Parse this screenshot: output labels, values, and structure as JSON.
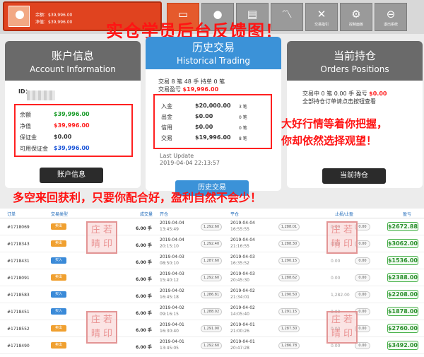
{
  "user": {
    "balance_label": "余额：",
    "balance": "$39,996.00",
    "equity_label": "净值：",
    "equity": "$39,996.00"
  },
  "nav": [
    "",
    "",
    "",
    "",
    "交易指引",
    "控制面板",
    "退出系统"
  ],
  "banner_top": "实仓学员后台反馈图！",
  "account": {
    "title_cn": "账户信息",
    "title_en": "Account Information",
    "id_label": "ID：",
    "rows": [
      {
        "label": "余额",
        "value": "$39,996.00"
      },
      {
        "label": "净值",
        "value": "$39,996.00"
      },
      {
        "label": "保证金",
        "value": "$0.00"
      },
      {
        "label": "可用保证金",
        "value": "$39,996.00"
      }
    ],
    "button": "账户信息"
  },
  "history": {
    "title_cn": "历史交易",
    "title_en": "Historical Trading",
    "summary1": "交易 8 笔   48 手   持单 0 笔",
    "summary2_label": "交易盈亏",
    "summary2_value": "$19,996.00",
    "rows": [
      {
        "label": "入金",
        "value": "$20,000.00",
        "extra": "3 笔"
      },
      {
        "label": "出金",
        "value": "$0.00",
        "extra": "0 笔"
      },
      {
        "label": "信用",
        "value": "$0.00",
        "extra": "0 笔"
      },
      {
        "label": "交易",
        "value": "$19,996.00",
        "extra": "8 笔"
      }
    ],
    "last_update_label": "Last Update",
    "last_update": "2019-04-04 22:13:57",
    "button": "历史交易"
  },
  "positions": {
    "title_cn": "当前持仓",
    "title_en": "Orders Positions",
    "summary1": "交易中 0 笔   0.00 手   盈亏",
    "summary1_value": "$0.00",
    "summary2": "全部持仓订单请点击按钮查看",
    "button": "当前持仓"
  },
  "annotation_right_1": "大好行情等着你把握，",
  "annotation_right_2": "你却依然选择观望！",
  "annotation_mid": "多空来回获利，只要你配合好，盈利自然不会少！",
  "table": {
    "headers": [
      "订单",
      "交易类型",
      "成交量",
      "开仓",
      "平仓",
      "止损/止盈",
      "盈亏"
    ],
    "rows": [
      {
        "order": "#1718069",
        "type": "卖出",
        "side": "sell",
        "vol": "6.00 手",
        "open_date": "2019-04-04",
        "open_time": "13:45:49",
        "open_price": "1,292.60",
        "close_date": "2019-04-04",
        "close_time": "16:55:55",
        "close_price": "1,288.01",
        "sl": "0.00",
        "profit": "$2672.88"
      },
      {
        "order": "#1718343",
        "type": "卖出",
        "side": "sell",
        "vol": "6.00 手",
        "open_date": "2019-04-04",
        "open_time": "20:15:10",
        "open_price": "1,292.40",
        "close_date": "2019-04-04",
        "close_time": "21:16:55",
        "close_price": "1,288.30",
        "sl": "0.00",
        "profit": "$3062.00"
      },
      {
        "order": "#1718431",
        "type": "买入",
        "side": "buy",
        "vol": "6.00 手",
        "open_date": "2019-04-03",
        "open_time": "08:50:10",
        "open_price": "1,287.60",
        "close_date": "2019-04-03",
        "close_time": "16:35:52",
        "close_price": "1,290.15",
        "sl": "0.00",
        "profit": "$1536.00"
      },
      {
        "order": "#1718091",
        "type": "卖出",
        "side": "sell",
        "vol": "6.00 手",
        "open_date": "2019-04-03",
        "open_time": "15:40:12",
        "open_price": "1,292.60",
        "close_date": "2019-04-03",
        "close_time": "20:45:30",
        "close_price": "1,288.62",
        "sl": "0.00",
        "profit": "$2388.00"
      },
      {
        "order": "#1718583",
        "type": "买入",
        "side": "buy",
        "vol": "6.00 手",
        "open_date": "2019-04-02",
        "open_time": "16:45:18",
        "open_price": "1,286.81",
        "close_date": "2019-04-02",
        "close_time": "21:34:01",
        "close_price": "1,290.50",
        "sl": "1,282.00",
        "profit": "$2208.00"
      },
      {
        "order": "#1718451",
        "type": "买入",
        "side": "buy",
        "vol": "6.00 手",
        "open_date": "2019-04-02",
        "open_time": "09:16:15",
        "open_price": "1,288.02",
        "close_date": "2019-04-02",
        "close_time": "14:05:40",
        "close_price": "1,291.15",
        "sl": "0.00",
        "profit": "$1878.00"
      },
      {
        "order": "#1718552",
        "type": "卖出",
        "side": "sell",
        "vol": "6.00 手",
        "open_date": "2019-04-01",
        "open_time": "16:30:40",
        "open_price": "1,291.90",
        "close_date": "2019-04-01",
        "close_time": "21:00:26",
        "close_price": "1,287.30",
        "sl": "0.00",
        "profit": "$2760.00"
      },
      {
        "order": "#1718490",
        "type": "卖出",
        "side": "sell",
        "vol": "6.00 手",
        "open_date": "2019-04-01",
        "open_time": "13:45:05",
        "open_price": "1,292.60",
        "close_date": "2019-04-01",
        "close_time": "20:47:28",
        "close_price": "1,286.78",
        "sl": "0.00",
        "profit": "$3492.00"
      }
    ]
  },
  "seal_text": "庄若晴印",
  "seal_lines": [
    "庄 若",
    "晴 印"
  ]
}
